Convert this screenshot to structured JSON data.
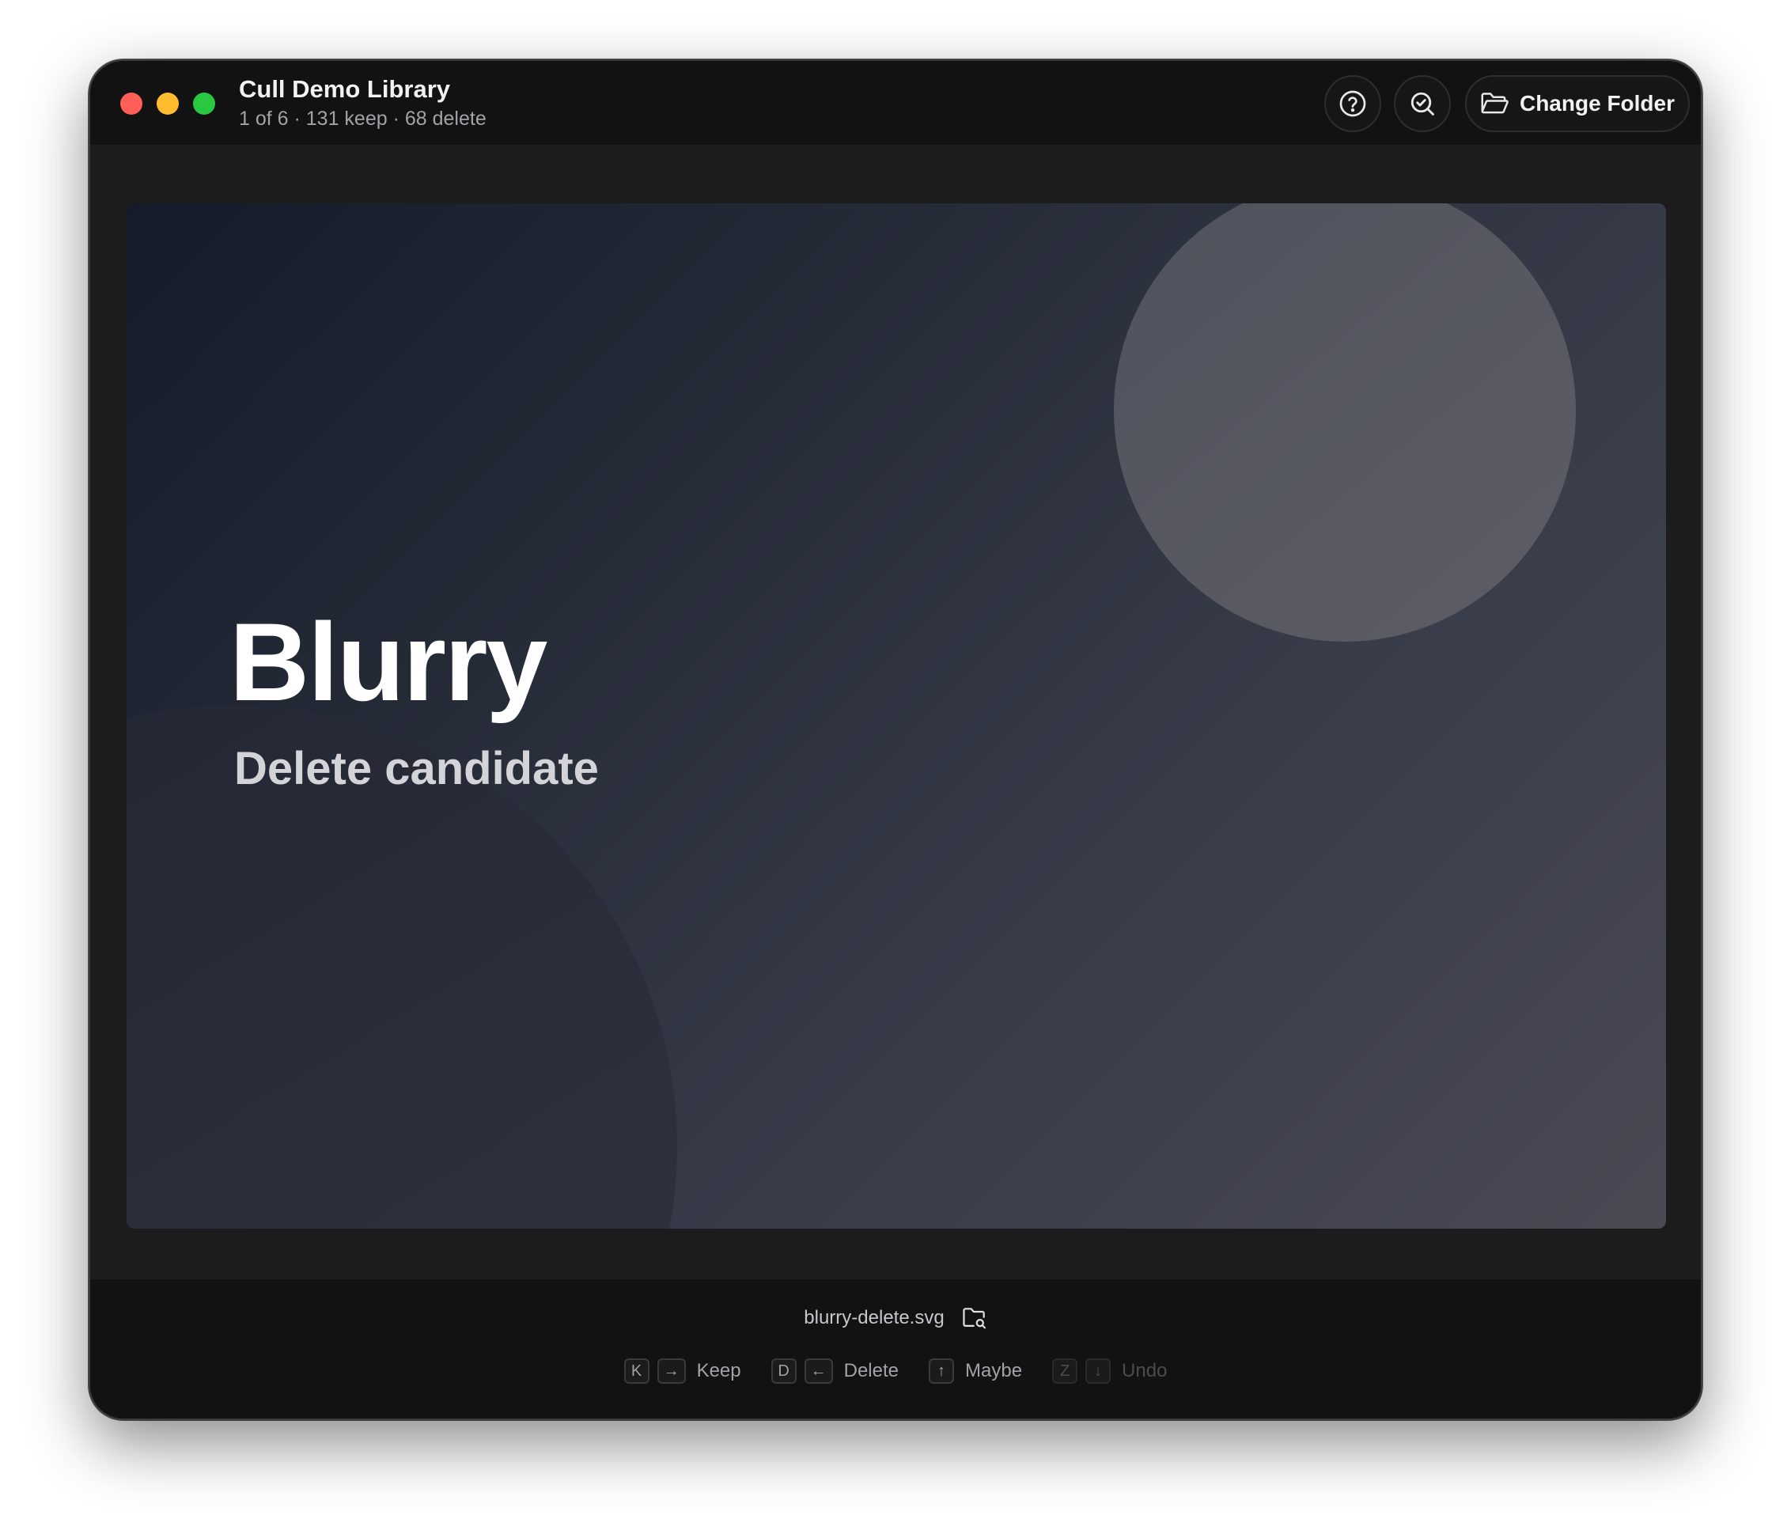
{
  "window": {
    "title": "Cull Demo Library",
    "subtitle": "1 of 6 · 131 keep · 68 delete"
  },
  "toolbar": {
    "help_icon": "question-circle-icon",
    "review_icon": "search-check-icon",
    "change_folder_label": "Change Folder",
    "change_folder_icon": "folder-open-icon"
  },
  "photo": {
    "title": "Blurry",
    "subtitle": "Delete candidate"
  },
  "footer": {
    "filename": "blurry-delete.svg",
    "reveal_icon": "folder-search-icon",
    "shortcuts": [
      {
        "keys": [
          "K",
          "→"
        ],
        "label": "Keep",
        "enabled": true
      },
      {
        "keys": [
          "D",
          "←"
        ],
        "label": "Delete",
        "enabled": true
      },
      {
        "keys": [
          "↑"
        ],
        "label": "Maybe",
        "enabled": true
      },
      {
        "keys": [
          "Z",
          "↓"
        ],
        "label": "Undo",
        "enabled": false
      }
    ]
  },
  "colors": {
    "close": "#ff5f57",
    "minimize": "#febc2e",
    "maximize": "#28c840",
    "window_bg": "#1c1c1d",
    "bar_bg": "#121213"
  }
}
